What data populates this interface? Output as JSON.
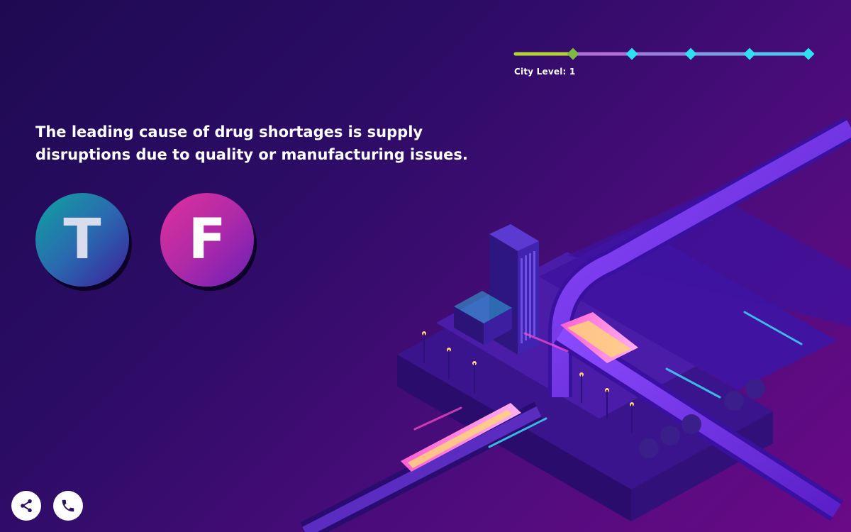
{
  "question": {
    "text": "The leading cause of drug shortages is supply disruptions due to quality or manufacturing issues."
  },
  "answers": {
    "true_label": "T",
    "false_label": "F"
  },
  "progress": {
    "label": "City Level: 1",
    "current_level": 1,
    "total_markers": 5,
    "colors": {
      "completed_track": "#b6d233",
      "completed_marker": "#7fb843",
      "upcoming_marker": "#2fe0f2"
    }
  },
  "toolbar": {
    "share_icon": "share-icon",
    "phone_icon": "phone-icon"
  },
  "theme": {
    "background_top_left": "#1e0a52",
    "background_bottom_right": "#6a0a86"
  }
}
